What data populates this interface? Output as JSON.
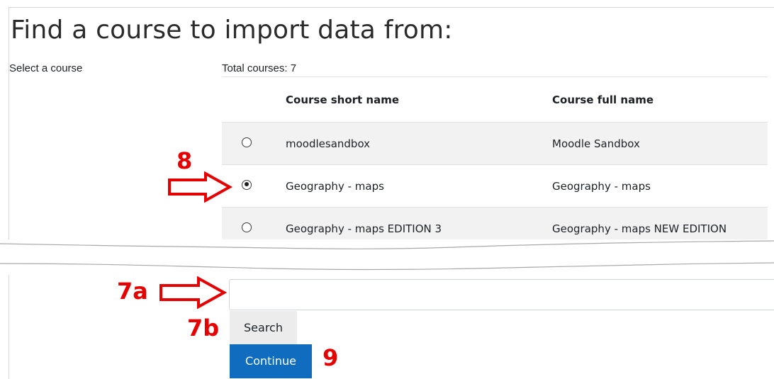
{
  "page": {
    "title": "Find a course to import data from:",
    "select_label": "Select a course",
    "total_courses": "Total courses: 7"
  },
  "table": {
    "headers": [
      "",
      "Course short name",
      "Course full name"
    ],
    "rows": [
      {
        "short": "moodlesandbox",
        "full": "Moodle Sandbox",
        "selected": false
      },
      {
        "short": "Geography - maps",
        "full": "Geography - maps",
        "selected": true
      },
      {
        "short": "Geography - maps EDITION 3",
        "full": "Geography - maps NEW EDITION",
        "selected": false
      }
    ]
  },
  "search": {
    "value": "",
    "button_label": "Search"
  },
  "continue_label": "Continue",
  "annotations": {
    "step_select": "8",
    "step_input": "7a",
    "step_search": "7b",
    "step_continue": "9",
    "color": "#e60000"
  },
  "colors": {
    "primary_button": "#0f6cbf",
    "secondary_button": "#ececec",
    "row_stripe": "#f2f2f2"
  }
}
